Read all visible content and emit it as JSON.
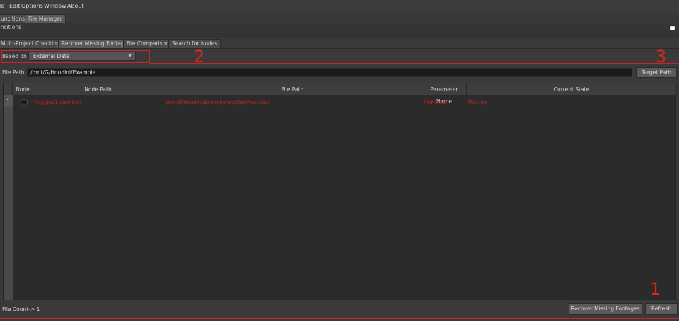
{
  "menubar": {
    "items": [
      "le",
      "Edit",
      "Options",
      "Window",
      "About"
    ]
  },
  "top_tabs": [
    "uncitions",
    "File Manager"
  ],
  "panel_label": "uncitions",
  "function_tabs": [
    "Multi-Project Checking",
    "Recover Missing Footages",
    "File Comparison",
    "Search for Nodes"
  ],
  "based_on": {
    "label": "Based on",
    "value": "External Data"
  },
  "file_path": {
    "label": "File Path",
    "value": "/mnt/G/Houdini/Example",
    "button": "Target Path"
  },
  "table": {
    "columns": [
      "Node",
      "Node Path",
      "File Path",
      "Parameter Name",
      "Current State"
    ],
    "rows": [
      {
        "num": "1",
        "node_path": "/obj/geo1/alembic1",
        "file_path": "/mnt/G/Houdini/Example/abc/test/test.abc",
        "param": "fileName",
        "state": "Missing"
      }
    ]
  },
  "footer": {
    "count": "File Count-> 1",
    "recover": "Recover Missing Footages",
    "refresh": "Refresh"
  },
  "annotations": {
    "n1": "1",
    "n2": "2",
    "n3": "3"
  },
  "colors": {
    "annotation": "#d2202a",
    "missing_text": "#c8221f"
  }
}
